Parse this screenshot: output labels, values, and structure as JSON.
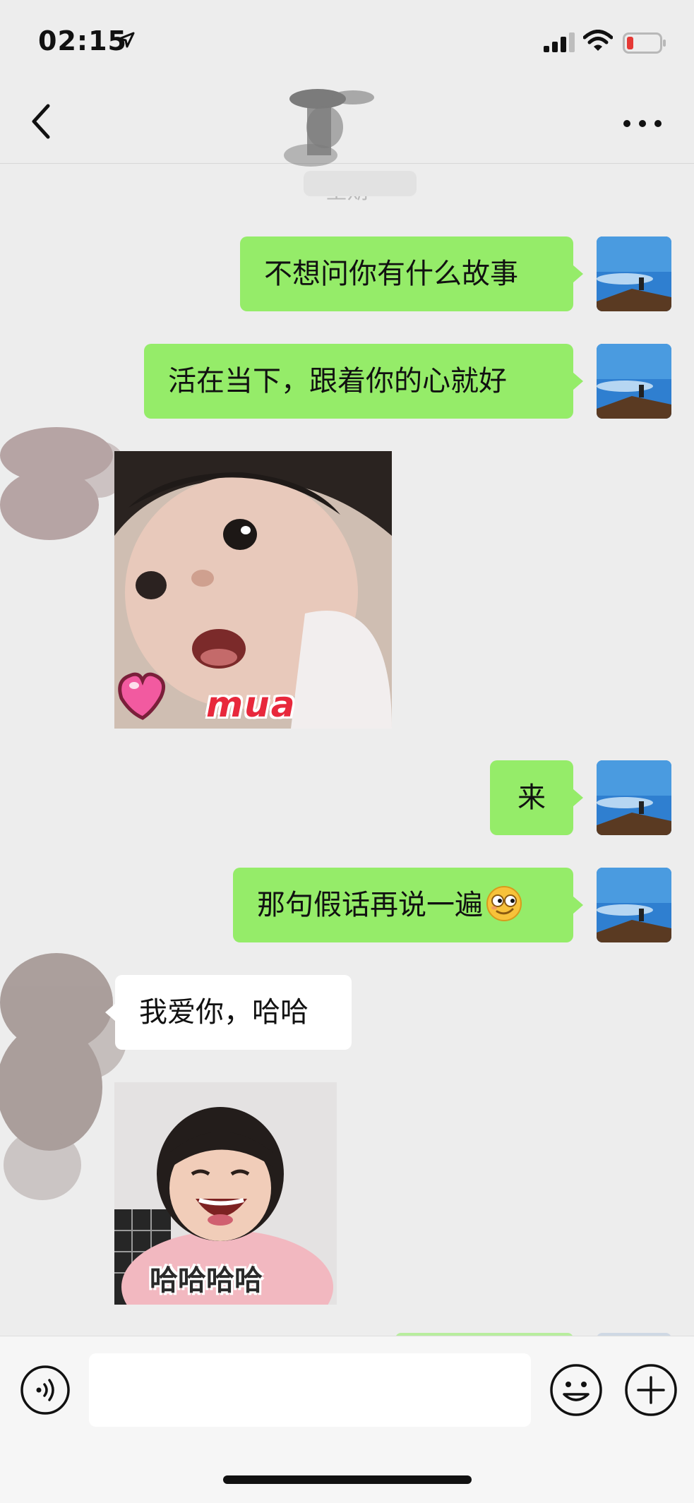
{
  "status_bar": {
    "time": "02:15",
    "location_icon": "location-arrow-icon",
    "signal_icon": "cellular-signal-icon",
    "wifi_icon": "wifi-icon",
    "battery_icon": "battery-low-icon"
  },
  "nav": {
    "back_icon": "chevron-left-icon",
    "more_icon": "ellipsis-icon"
  },
  "chat": {
    "date_label": "星期",
    "messages": [
      {
        "side": "out",
        "type": "text",
        "text": "不想问你有什么故事"
      },
      {
        "side": "out",
        "type": "text",
        "text": "活在当下，跟着你的心就好"
      },
      {
        "side": "in",
        "type": "sticker",
        "caption": "mua"
      },
      {
        "side": "out",
        "type": "text",
        "text": "来"
      },
      {
        "side": "out",
        "type": "text",
        "text": "那句假话再说一遍"
      },
      {
        "side": "in",
        "type": "text",
        "text": "我爱你，哈哈"
      },
      {
        "side": "in",
        "type": "sticker",
        "caption": "哈哈哈哈"
      }
    ]
  },
  "input_bar": {
    "voice_icon": "voice-icon",
    "input_value": "",
    "emoji_icon": "smiley-icon",
    "plus_icon": "plus-icon"
  },
  "colors": {
    "background": "#ededed",
    "outgoing_bubble": "#95ec69",
    "incoming_bubble": "#ffffff",
    "input_bar": "#f6f6f6"
  }
}
